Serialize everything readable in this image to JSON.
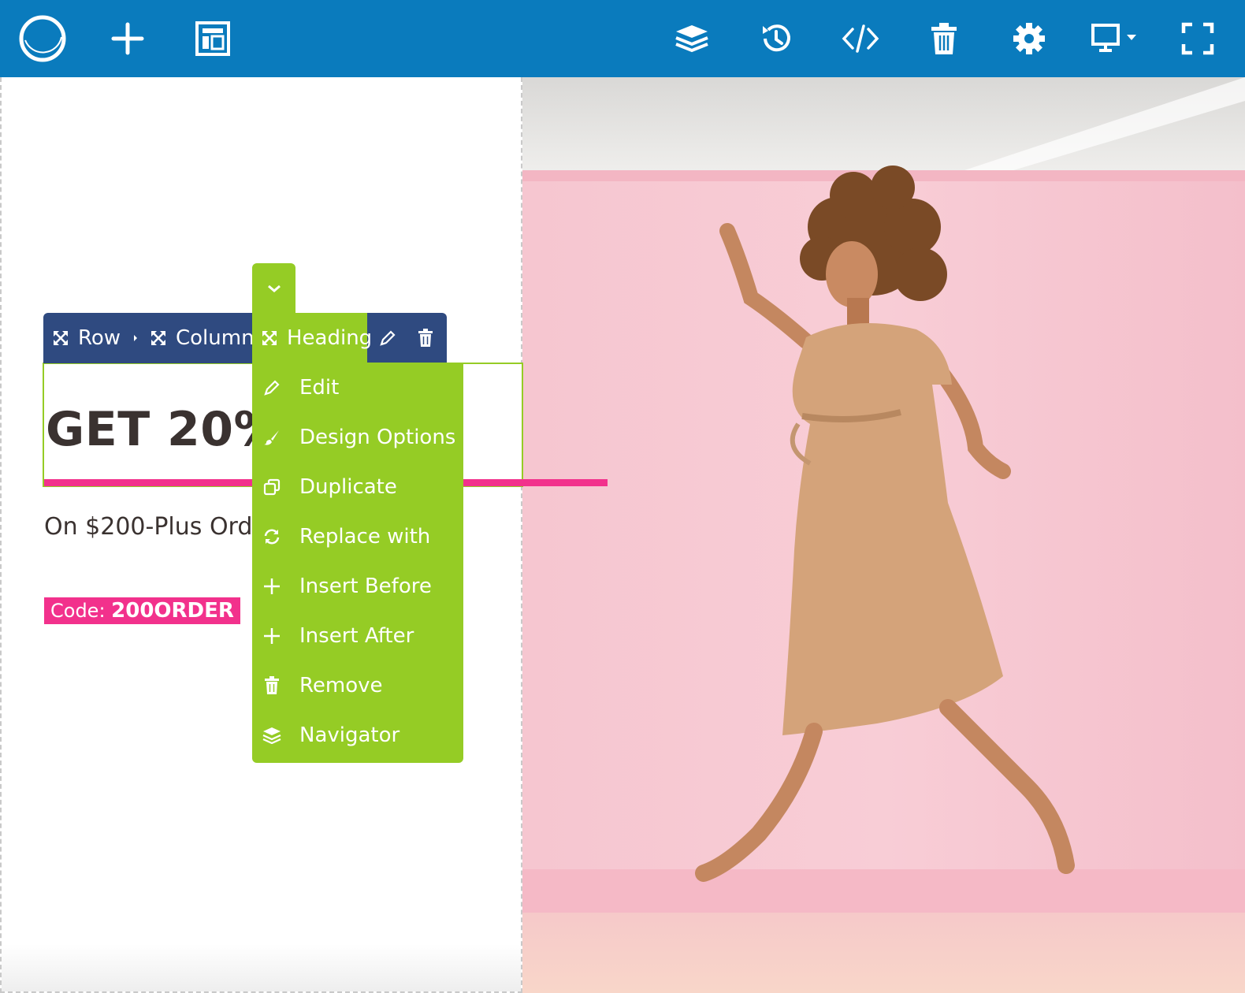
{
  "toolbar": {
    "left": [
      "logo-icon",
      "add-icon",
      "layout-icon"
    ],
    "right": [
      "layers-icon",
      "history-icon",
      "code-icon",
      "trash-icon",
      "gear-icon",
      "desktop-icon",
      "fullscreen-icon"
    ],
    "color": "#0a7bbd"
  },
  "breadcrumb": {
    "items": [
      {
        "label": "Row",
        "icon": "move-icon"
      },
      {
        "label": "Column",
        "icon": "move-icon"
      },
      {
        "label": "Heading",
        "icon": "move-icon"
      }
    ],
    "color": "#2f4a80",
    "active_color": "#95cc25"
  },
  "context_menu": {
    "items": [
      {
        "label": "Edit",
        "icon": "pencil-icon"
      },
      {
        "label": "Design Options",
        "icon": "brush-icon"
      },
      {
        "label": "Duplicate",
        "icon": "duplicate-icon"
      },
      {
        "label": "Replace with",
        "icon": "refresh-icon"
      },
      {
        "label": "Insert Before",
        "icon": "plus-icon"
      },
      {
        "label": "Insert After",
        "icon": "plus-icon"
      },
      {
        "label": "Remove",
        "icon": "trash-icon"
      },
      {
        "label": "Navigator",
        "icon": "layers-icon"
      }
    ]
  },
  "content": {
    "heading": "GET 20%",
    "subtext": "On $200-Plus Ord",
    "code_label": "Code: ",
    "code_value": "200ORDER",
    "accent_color": "#f2318c"
  }
}
